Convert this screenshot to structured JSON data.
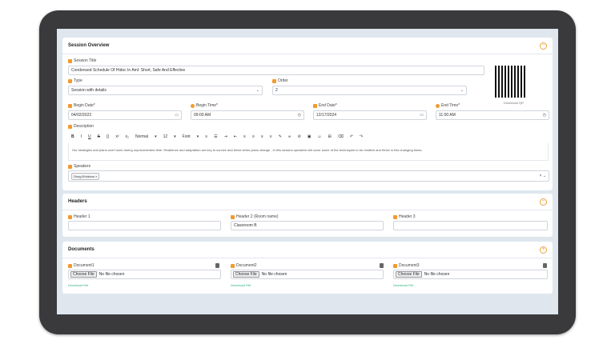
{
  "session": {
    "title": "Session Overview",
    "fields": {
      "session_title_label": "Session Title",
      "session_title_value": "Condensed Schedule Of Hidoc In Aml: Short, Safe And Effective",
      "type_label": "Type",
      "type_value": "Session with details",
      "order_label": "Order",
      "order_value": "2",
      "begin_date_label": "Begin Date*",
      "begin_date_value": "04/02/2023",
      "begin_time_label": "Begin Time*",
      "begin_time_value": "09:00 AM",
      "end_date_label": "End Date*",
      "end_date_value": "12/17/2024",
      "end_time_label": "End Time*",
      "end_time_value": "11:00 AM",
      "description_label": "Description",
      "description_value": "Our strategies and plans won't work during unprecedented time. Resilience and adaptation are key to survive and thrive when plans change . In this session speakers will cover some of the techniques to be resilient and thrive in this changing times.",
      "speakers_label": "Speakers",
      "speaker_chip": "Doug Erickson"
    },
    "qr_link": "Download QR",
    "toolbar": {
      "bold": "B",
      "italic": "I",
      "underline": "U",
      "strike": "S",
      "code": "{}",
      "sup": "x²",
      "sub": "x₂",
      "normal": "Normal",
      "size": "12",
      "font": "Font"
    }
  },
  "headers": {
    "title": "Headers",
    "h1_label": "Header 1",
    "h1_value": "",
    "h2_label": "Header 2 (Room name)",
    "h2_value": "Classroom B",
    "h3_label": "Header 3",
    "h3_value": ""
  },
  "documents": {
    "title": "Documents",
    "docs": [
      {
        "label": "Document1",
        "btn": "Choose File",
        "status": "No file chosen",
        "download": "Download File"
      },
      {
        "label": "Document2",
        "btn": "Choose File",
        "status": "No file chosen",
        "download": "Download File"
      },
      {
        "label": "Document3",
        "btn": "Choose File",
        "status": "No file chosen",
        "download": "Download File"
      }
    ]
  },
  "colors": {
    "accent": "#f29a2e",
    "link_green": "#2fb37a",
    "device_bezel": "#3a3a3c",
    "screen_bg": "#dfe6ee"
  }
}
